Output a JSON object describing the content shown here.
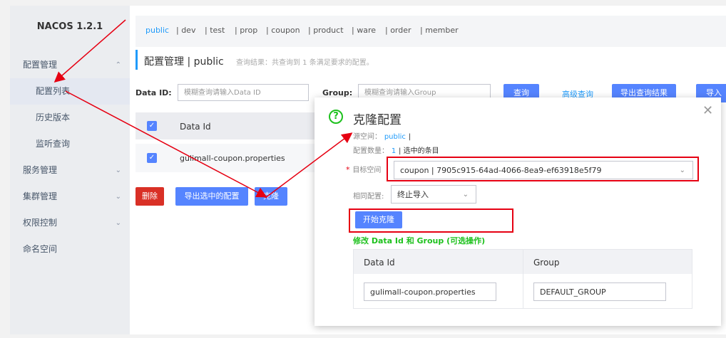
{
  "sidebar": {
    "brand": "NACOS 1.2.1",
    "sections": [
      {
        "label": "配置管理",
        "chevron": "^"
      },
      {
        "label": "服务管理",
        "chevron": "v"
      },
      {
        "label": "集群管理",
        "chevron": "v"
      },
      {
        "label": "权限控制",
        "chevron": "v"
      },
      {
        "label": "命名空间",
        "chevron": ""
      }
    ],
    "subitems": [
      "配置列表",
      "历史版本",
      "监听查询"
    ]
  },
  "namespaces": [
    "public",
    "| dev",
    "| test",
    "| prop",
    "| coupon",
    "| product",
    "| ware",
    "| order",
    "| member"
  ],
  "page": {
    "title": "配置管理 | public",
    "hint": "查询结果：共查询到 1 条满足要求的配置。"
  },
  "search": {
    "dataid_label": "Data ID:",
    "dataid_placeholder": "模糊查询请输入Data ID",
    "group_label": "Group:",
    "group_placeholder": "模糊查询请输入Group",
    "query_button": "查询",
    "advanced_button": "高级查询",
    "export_button": "导出查询结果",
    "import_button": "导入"
  },
  "table": {
    "header_dataid": "Data Id",
    "rows": [
      {
        "dataid": "gulimall-coupon.properties"
      }
    ]
  },
  "actions": {
    "delete": "删除",
    "export_selected": "导出选中的配置",
    "clone": "克隆"
  },
  "dialog": {
    "title": "克隆配置",
    "source_ns_label": "源空间：",
    "source_ns_value": "public",
    "source_ns_sep": "|",
    "count_label": "配置数量：",
    "count_value": "1",
    "count_suffix": "| 选中的条目",
    "target_required": "*",
    "target_label": "目标空间",
    "target_value": "coupon | 7905c915-64ad-4066-8ea9-ef63918e5f79",
    "same_label": "相同配置:",
    "same_value": "终止导入",
    "start_button": "开始克隆",
    "modify_hint": "修改 Data Id 和 Group (可选操作)",
    "col_dataid": "Data Id",
    "col_group": "Group",
    "row_dataid": "gulimall-coupon.properties",
    "row_group": "DEFAULT_GROUP"
  },
  "colors": {
    "primary": "#5584ff",
    "danger": "#d93026",
    "link": "#209bfa",
    "success": "#1dc11d",
    "annotation": "#e60012"
  }
}
